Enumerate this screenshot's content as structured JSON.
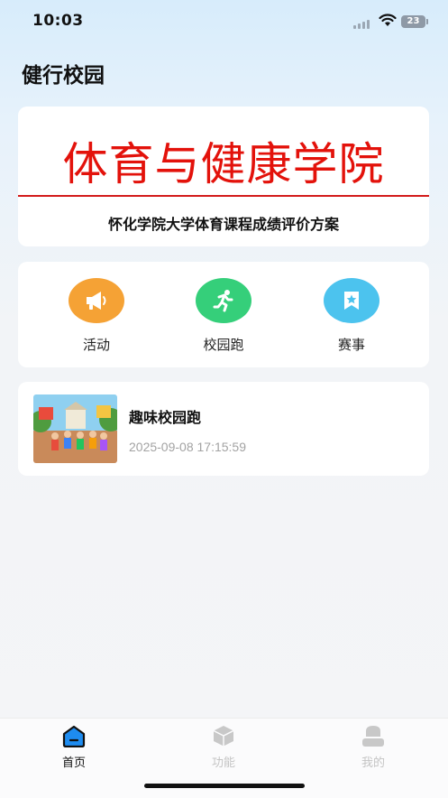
{
  "status_bar": {
    "time": "10:03",
    "battery": "23"
  },
  "app_title": "健行校园",
  "banner": {
    "title": "体育与健康学院",
    "subtitle": "怀化学院大学体育课程成绩评价方案"
  },
  "quick_actions": [
    {
      "label": "活动",
      "icon": "megaphone-icon",
      "color": "#f5a030"
    },
    {
      "label": "校园跑",
      "icon": "runner-icon",
      "color": "#35cf7a"
    },
    {
      "label": "赛事",
      "icon": "star-badge-icon",
      "color": "#4cc3ee"
    }
  ],
  "news": {
    "title": "趣味校园跑",
    "time": "2025-09-08 17:15:59"
  },
  "tabs": [
    {
      "label": "首页",
      "icon": "home-icon",
      "active": true
    },
    {
      "label": "功能",
      "icon": "cube-icon",
      "active": false
    },
    {
      "label": "我的",
      "icon": "user-icon",
      "active": false
    }
  ],
  "colors": {
    "active_tab": "#111111",
    "inactive_tab": "#c4c4c4",
    "banner_red": "#e3120b"
  }
}
